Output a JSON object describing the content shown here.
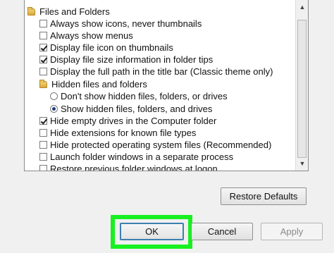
{
  "tree": {
    "items": [
      {
        "kind": "folder",
        "label": "Files and Folders",
        "indent": 0
      },
      {
        "kind": "checkbox",
        "label": "Always show icons, never thumbnails",
        "checked": false
      },
      {
        "kind": "checkbox",
        "label": "Always show menus",
        "checked": false
      },
      {
        "kind": "checkbox",
        "label": "Display file icon on thumbnails",
        "checked": true
      },
      {
        "kind": "checkbox",
        "label": "Display file size information in folder tips",
        "checked": true
      },
      {
        "kind": "checkbox",
        "label": "Display the full path in the title bar (Classic theme only)",
        "checked": false
      },
      {
        "kind": "folder",
        "label": "Hidden files and folders",
        "indent": 1
      },
      {
        "kind": "radio",
        "label": "Don't show hidden files, folders, or drives",
        "selected": false
      },
      {
        "kind": "radio",
        "label": "Show hidden files, folders, and drives",
        "selected": true
      },
      {
        "kind": "checkbox",
        "label": "Hide empty drives in the Computer folder",
        "checked": true
      },
      {
        "kind": "checkbox",
        "label": "Hide extensions for known file types",
        "checked": false
      },
      {
        "kind": "checkbox",
        "label": "Hide protected operating system files (Recommended)",
        "checked": false
      },
      {
        "kind": "checkbox",
        "label": "Launch folder windows in a separate process",
        "checked": false
      },
      {
        "kind": "checkbox",
        "label": "Restore previous folder windows at logon",
        "checked": false
      }
    ]
  },
  "buttons": {
    "restore_defaults": "Restore Defaults",
    "ok": "OK",
    "cancel": "Cancel",
    "apply": "Apply"
  },
  "icons": {
    "scroll_up": "▲",
    "scroll_down": "▼"
  },
  "colors": {
    "highlight": "#19f022"
  }
}
